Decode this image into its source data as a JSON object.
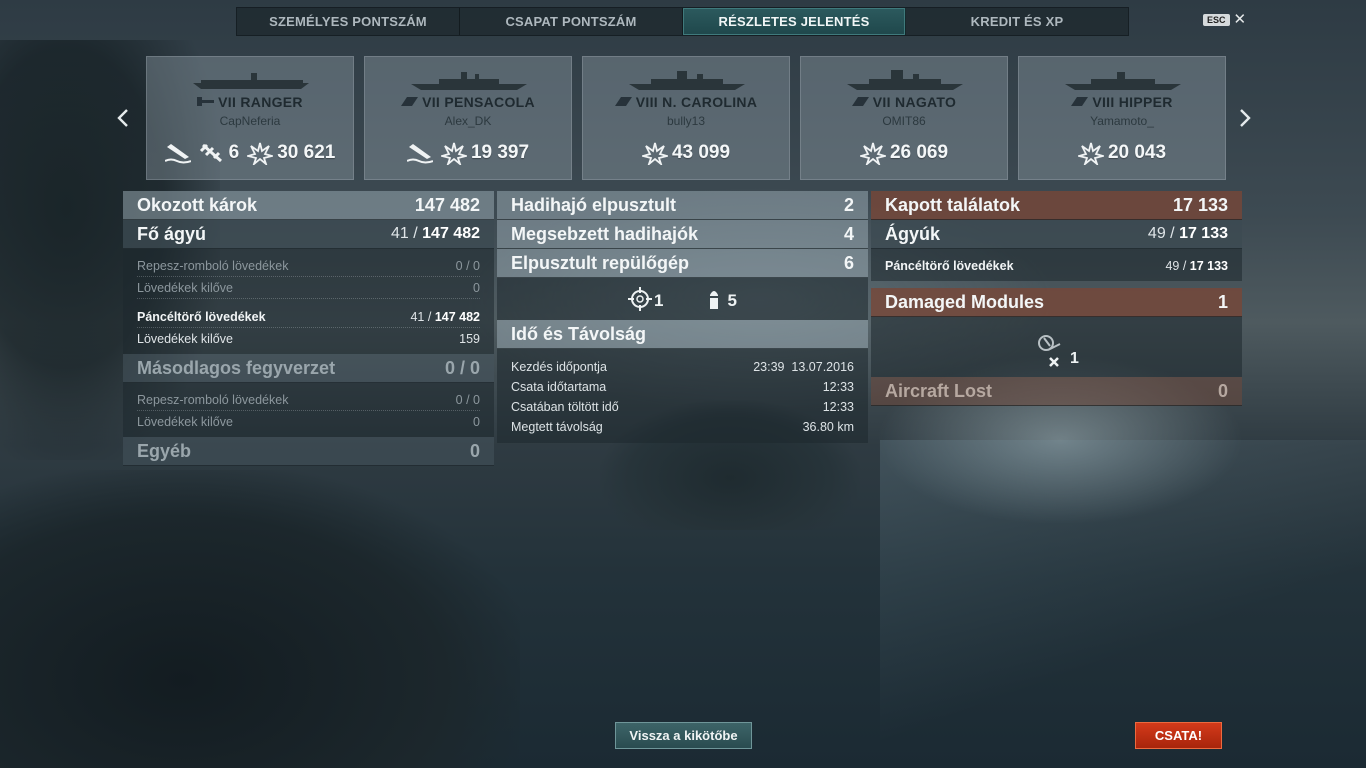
{
  "tabs": [
    {
      "label": "SZEMÉLYES PONTSZÁM",
      "active": false
    },
    {
      "label": "CSAPAT PONTSZÁM",
      "active": false
    },
    {
      "label": "RÉSZLETES JELENTÉS",
      "active": true
    },
    {
      "label": "KREDIT ÉS XP",
      "active": false
    }
  ],
  "esc": {
    "key": "ESC",
    "close": "✕"
  },
  "ships": [
    {
      "tier": "VII",
      "name": "RANGER",
      "player": "CapNeferia",
      "class": "aircraft-carrier",
      "torpedo_hit_icon": true,
      "planes_shot": "6",
      "damage": "30 621"
    },
    {
      "tier": "VII",
      "name": "PENSACOLA",
      "player": "Alex_DK",
      "class": "cruiser",
      "torpedo_hit_icon": true,
      "damage": "19 397"
    },
    {
      "tier": "VIII",
      "name": "N. CAROLINA",
      "player": "bully13",
      "class": "battleship",
      "damage": "43 099"
    },
    {
      "tier": "VII",
      "name": "NAGATO",
      "player": "OMIT86",
      "class": "battleship",
      "damage": "26 069"
    },
    {
      "tier": "VIII",
      "name": "HIPPER",
      "player": "Yamamoto_",
      "class": "cruiser",
      "damage": "20 043"
    }
  ],
  "damage_dealt": {
    "title": "Okozott károk",
    "total": "147 482",
    "main_battery": {
      "label": "Fő ágyú",
      "hits": "41",
      "damage": "147 482"
    },
    "he": {
      "label": "Repesz-romboló lövedékek",
      "value": "0 / 0"
    },
    "he_fired": {
      "label": "Lövedékek kilőve",
      "value": "0"
    },
    "ap": {
      "label": "Páncéltörő lövedékek",
      "hits": "41",
      "damage": "147 482"
    },
    "ap_fired": {
      "label": "Lövedékek kilőve",
      "value": "159"
    },
    "secondary": {
      "label": "Másodlagos fegyverzet",
      "value": "0 / 0"
    },
    "sec_he": {
      "label": "Repesz-romboló lövedékek",
      "value": "0 / 0"
    },
    "sec_fired": {
      "label": "Lövedékek kilőve",
      "value": "0"
    },
    "other": {
      "label": "Egyéb",
      "value": "0"
    }
  },
  "kills": {
    "ships_destroyed": {
      "label": "Hadihajó elpusztult",
      "value": "2"
    },
    "ships_damaged": {
      "label": "Megsebzett hadihajók",
      "value": "4"
    },
    "planes_destroyed": {
      "label": "Elpusztult repülőgép",
      "value": "6"
    },
    "spotted": "1",
    "ammo": "5"
  },
  "time": {
    "title": "Idő és Távolság",
    "rows": [
      {
        "label": "Kezdés időpontja",
        "value": "23:39  13.07.2016"
      },
      {
        "label": "Csata időtartama",
        "value": "12:33"
      },
      {
        "label": "Csatában töltött idő",
        "value": "12:33"
      },
      {
        "label": "Megtett távolság",
        "value": "36.80 km"
      }
    ]
  },
  "received": {
    "title": "Kapott találatok",
    "total": "17 133",
    "guns": {
      "label": "Ágyúk",
      "hits": "49",
      "damage": "17 133"
    },
    "ap": {
      "label": "Páncéltörő lövedékek",
      "hits": "49",
      "damage": "17 133"
    },
    "modules": {
      "label": "Damaged Modules",
      "value": "1",
      "count": "1"
    },
    "aircraft_lost": {
      "label": "Aircraft Lost",
      "value": "0"
    }
  },
  "buttons": {
    "port": "Vissza a kikötőbe",
    "battle": "CSATA!"
  }
}
